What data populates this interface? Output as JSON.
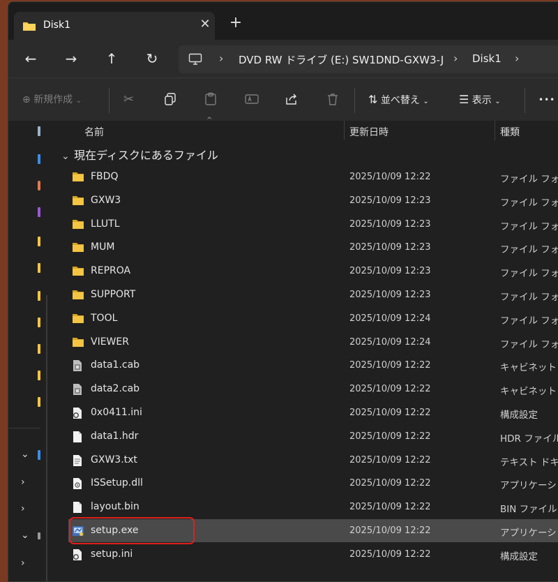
{
  "window": {
    "tab_title": "Disk1",
    "tab_close": "✕",
    "new_tab": "+"
  },
  "address_bar": {
    "crumbs": [
      "DVD RW ドライブ (E:) SW1DND-GXW3-J",
      "Disk1"
    ],
    "separator": "›"
  },
  "toolbar": {
    "new_label": "新規作成",
    "sort_label": "並べ替え",
    "view_label": "表示",
    "more_label": "•••"
  },
  "columns": {
    "name": "名前",
    "date": "更新日時",
    "type": "種類"
  },
  "group": {
    "label": "現在ディスクにあるファイル"
  },
  "files": [
    {
      "name": "FBDQ",
      "date": "2025/10/09 12:22",
      "type": "ファイル フォルダー",
      "icon": "folder"
    },
    {
      "name": "GXW3",
      "date": "2025/10/09 12:23",
      "type": "ファイル フォルダー",
      "icon": "folder"
    },
    {
      "name": "LLUTL",
      "date": "2025/10/09 12:23",
      "type": "ファイル フォルダー",
      "icon": "folder"
    },
    {
      "name": "MUM",
      "date": "2025/10/09 12:23",
      "type": "ファイル フォルダー",
      "icon": "folder"
    },
    {
      "name": "REPROA",
      "date": "2025/10/09 12:23",
      "type": "ファイル フォルダー",
      "icon": "folder"
    },
    {
      "name": "SUPPORT",
      "date": "2025/10/09 12:23",
      "type": "ファイル フォルダー",
      "icon": "folder"
    },
    {
      "name": "TOOL",
      "date": "2025/10/09 12:24",
      "type": "ファイル フォルダー",
      "icon": "folder"
    },
    {
      "name": "VIEWER",
      "date": "2025/10/09 12:24",
      "type": "ファイル フォルダー",
      "icon": "folder"
    },
    {
      "name": "data1.cab",
      "date": "2025/10/09 12:22",
      "type": "キャビネット ファイル",
      "icon": "cab"
    },
    {
      "name": "data2.cab",
      "date": "2025/10/09 12:22",
      "type": "キャビネット ファイル",
      "icon": "cab"
    },
    {
      "name": "0x0411.ini",
      "date": "2025/10/09 12:22",
      "type": "構成設定",
      "icon": "ini"
    },
    {
      "name": "data1.hdr",
      "date": "2025/10/09 12:22",
      "type": "HDR ファイル",
      "icon": "doc"
    },
    {
      "name": "GXW3.txt",
      "date": "2025/10/09 12:22",
      "type": "テキスト ドキュメント",
      "icon": "txt"
    },
    {
      "name": "ISSetup.dll",
      "date": "2025/10/09 12:22",
      "type": "アプリケーション拡張",
      "icon": "dll"
    },
    {
      "name": "layout.bin",
      "date": "2025/10/09 12:22",
      "type": "BIN ファイル",
      "icon": "doc"
    },
    {
      "name": "setup.exe",
      "date": "2025/10/09 12:22",
      "type": "アプリケーション",
      "icon": "exe",
      "selected": true
    },
    {
      "name": "setup.ini",
      "date": "2025/10/09 12:22",
      "type": "構成設定",
      "icon": "ini"
    }
  ],
  "colors": {
    "folder": "#f4c542",
    "selection": "#4a4a4a",
    "highlight_border": "#e0201a"
  }
}
